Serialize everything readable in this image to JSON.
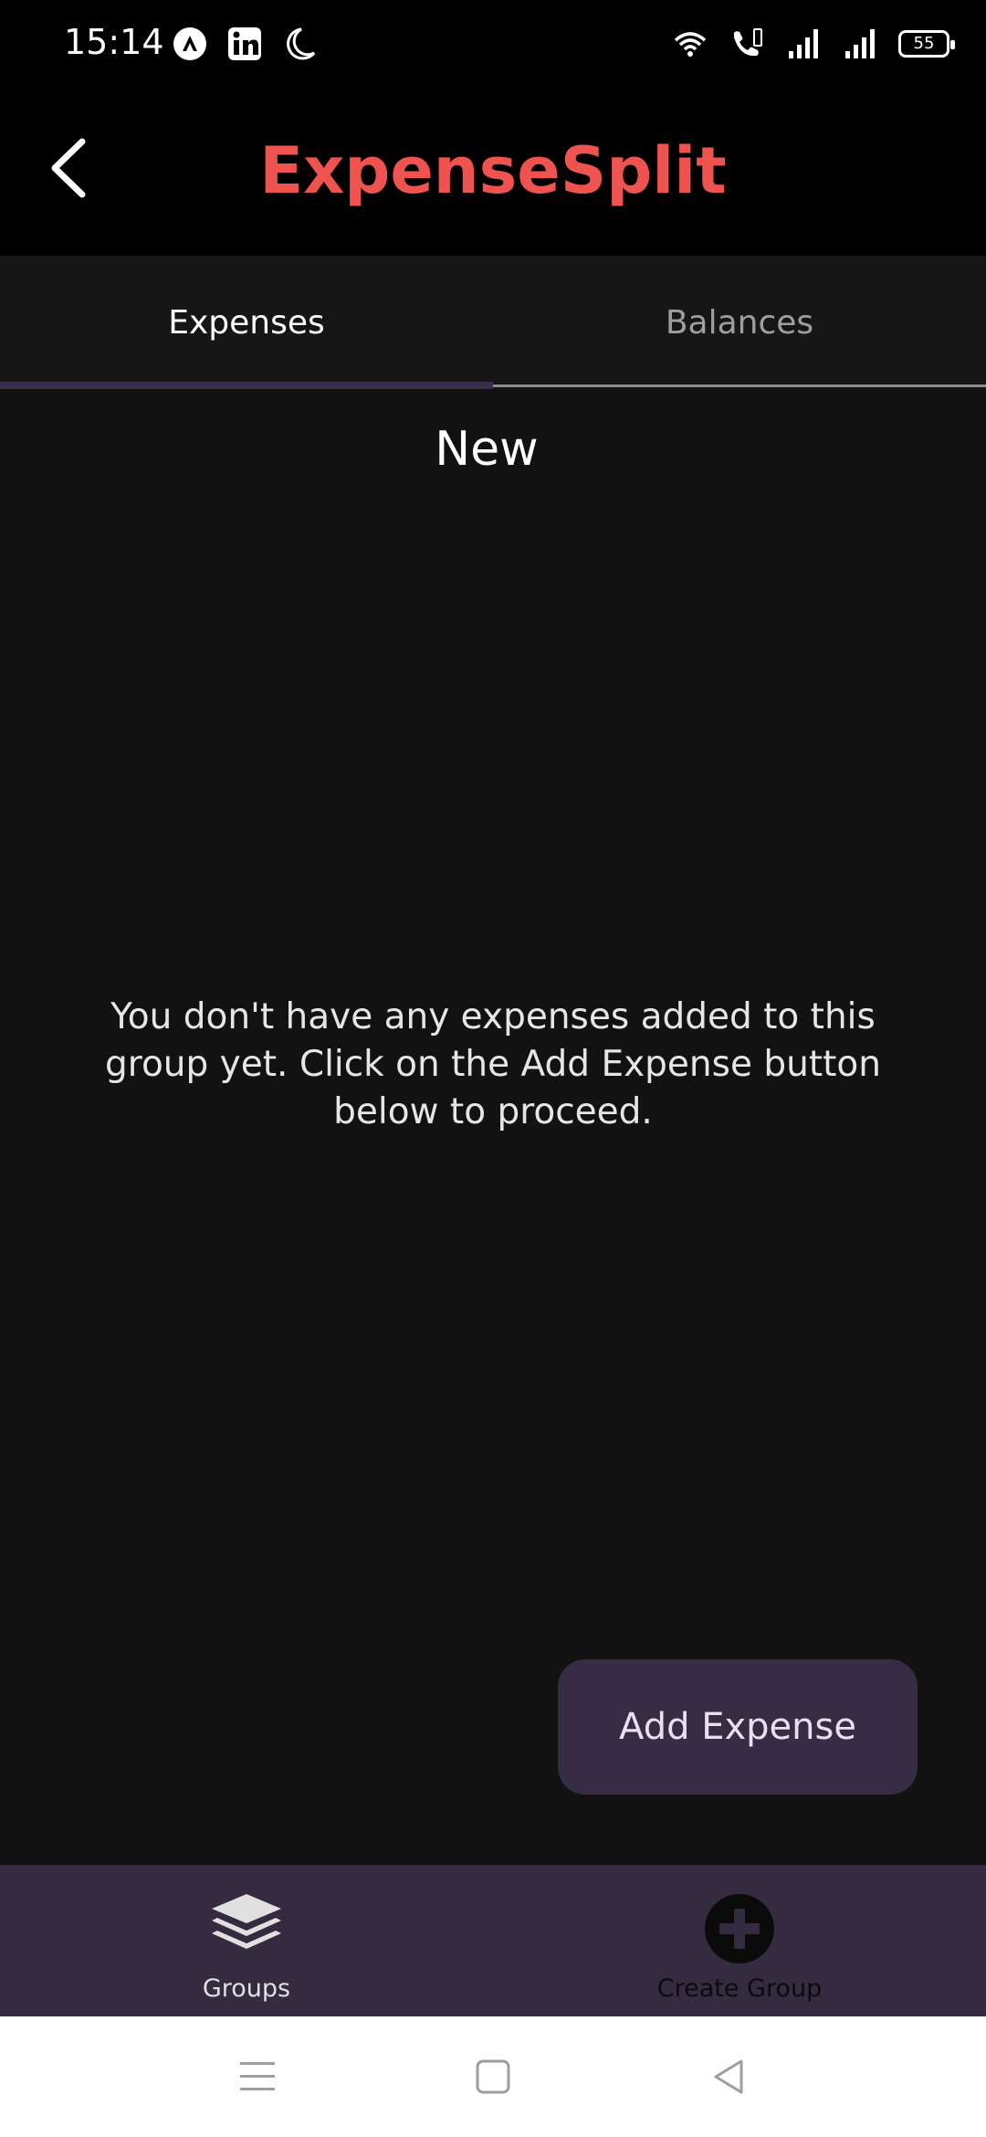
{
  "status_bar": {
    "time": "15:14",
    "battery": "55",
    "left_icons": [
      "assistant-icon",
      "linkedin-icon",
      "moon-icon"
    ],
    "right_icons": [
      "wifi-icon",
      "wifi-call-icon",
      "signal-icon",
      "signal-icon"
    ]
  },
  "app_bar": {
    "title": "ExpenseSplit",
    "title_color": "#ef5350"
  },
  "tabs": [
    {
      "label": "Expenses",
      "selected": true
    },
    {
      "label": "Balances",
      "selected": false
    }
  ],
  "group": {
    "name": "New"
  },
  "empty_state": {
    "message": "You don't have any expenses added to this group yet. Click on the Add Expense button below to proceed."
  },
  "actions": {
    "add_expense_label": "Add Expense"
  },
  "bottom_nav": [
    {
      "label": "Groups",
      "icon": "layers-icon"
    },
    {
      "label": "Create Group",
      "icon": "add-circle-icon"
    }
  ],
  "system_nav": [
    "menu-icon",
    "home-icon",
    "back-icon"
  ]
}
